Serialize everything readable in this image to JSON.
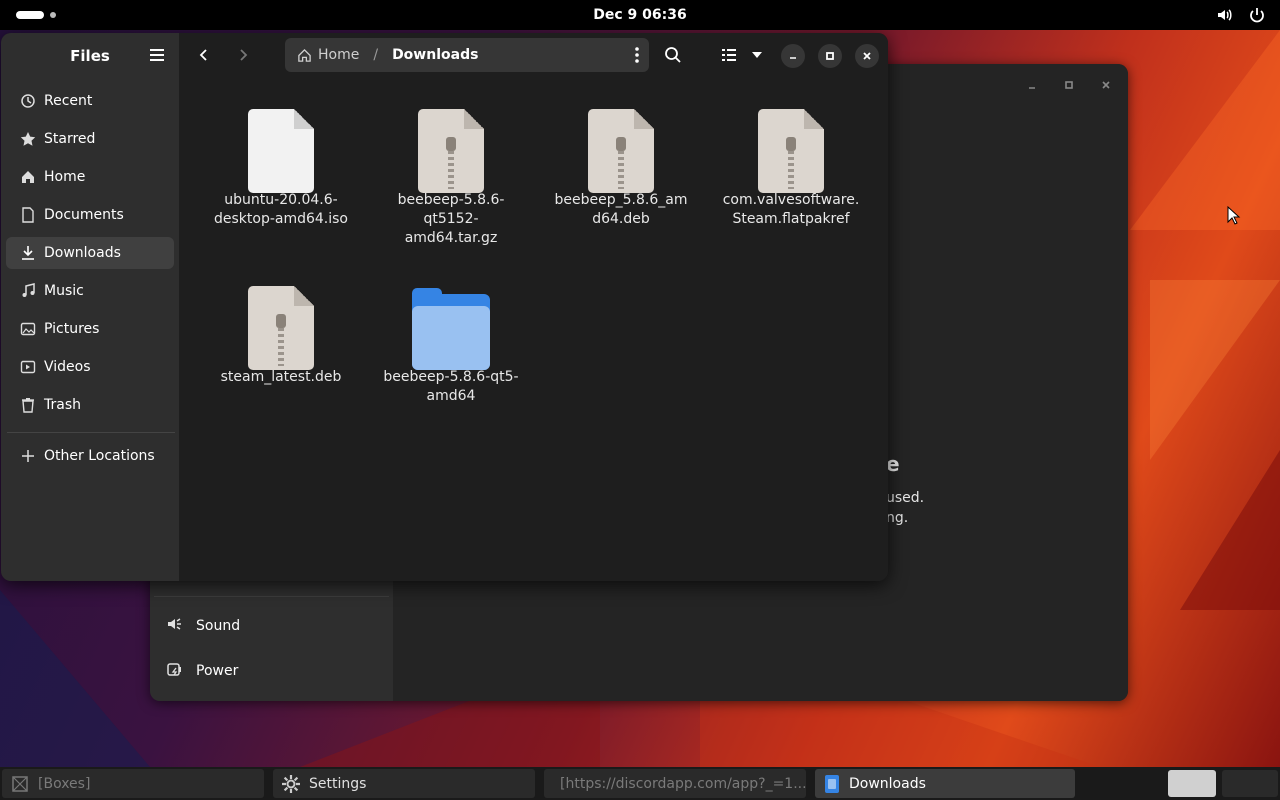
{
  "topbar": {
    "clock": "Dec 9  06:36",
    "icons": [
      "activities-indicator",
      "volume-icon",
      "power-icon"
    ]
  },
  "files": {
    "sidebar_title": "Files",
    "sidebar_items": [
      {
        "label": "Recent",
        "icon": "clock-icon"
      },
      {
        "label": "Starred",
        "icon": "star-icon"
      },
      {
        "label": "Home",
        "icon": "home-icon"
      },
      {
        "label": "Documents",
        "icon": "document-icon"
      },
      {
        "label": "Downloads",
        "icon": "download-icon",
        "active": true
      },
      {
        "label": "Music",
        "icon": "music-icon"
      },
      {
        "label": "Pictures",
        "icon": "picture-icon"
      },
      {
        "label": "Videos",
        "icon": "video-icon"
      },
      {
        "label": "Trash",
        "icon": "trash-icon"
      }
    ],
    "other_locations": "Other Locations",
    "path": {
      "home": "Home",
      "current": "Downloads"
    },
    "items": [
      {
        "name": "ubuntu-20.04.6-desktop-amd64.iso",
        "lines": [
          "ubuntu-20.04.6-",
          "desktop-amd64.iso"
        ],
        "type": "plain"
      },
      {
        "name": "beebeep-5.8.6-qt5152-amd64.tar.gz",
        "lines": [
          "beebeep-5.8.6-",
          "qt5152-",
          "amd64.tar.gz"
        ],
        "type": "zip"
      },
      {
        "name": "beebeep_5.8.6_amd64.deb",
        "lines": [
          "beebeep_5.8.6_am",
          "d64.deb"
        ],
        "type": "zip"
      },
      {
        "name": "com.valvesoftware.Steam.flatpakref",
        "lines": [
          "com.valvesoftware.",
          "Steam.flatpakref"
        ],
        "type": "zip"
      },
      {
        "name": "steam_latest.deb",
        "lines": [
          "steam_latest.deb"
        ],
        "type": "zip"
      },
      {
        "name": "beebeep-5.8.6-qt5-amd64",
        "lines": [
          "beebeep-5.8.6-qt5-",
          "amd64"
        ],
        "type": "folder"
      }
    ]
  },
  "settings": {
    "items": [
      {
        "label": "Sound",
        "icon": "speaker-icon"
      },
      {
        "label": "Power",
        "icon": "power-settings-icon"
      }
    ],
    "partial_heading": "e",
    "partial_lines": [
      "used.",
      "ng."
    ]
  },
  "taskbar": {
    "tasks": [
      {
        "label": "[Boxes]",
        "icon": "boxes-icon",
        "state": "inactive"
      },
      {
        "label": "Settings",
        "icon": "settings-gear-icon",
        "state": "normal"
      },
      {
        "label": "[https://discordapp.com/app?_=1...",
        "icon": "discord-icon",
        "state": "inactive"
      },
      {
        "label": "Downloads",
        "icon": "files-app-icon",
        "state": "active"
      }
    ]
  },
  "colors": {
    "accent": "#3584e4",
    "folder_light": "#99c1f1",
    "sidebar_bg": "#2e2e2e",
    "content_bg": "#1e1e1e"
  }
}
